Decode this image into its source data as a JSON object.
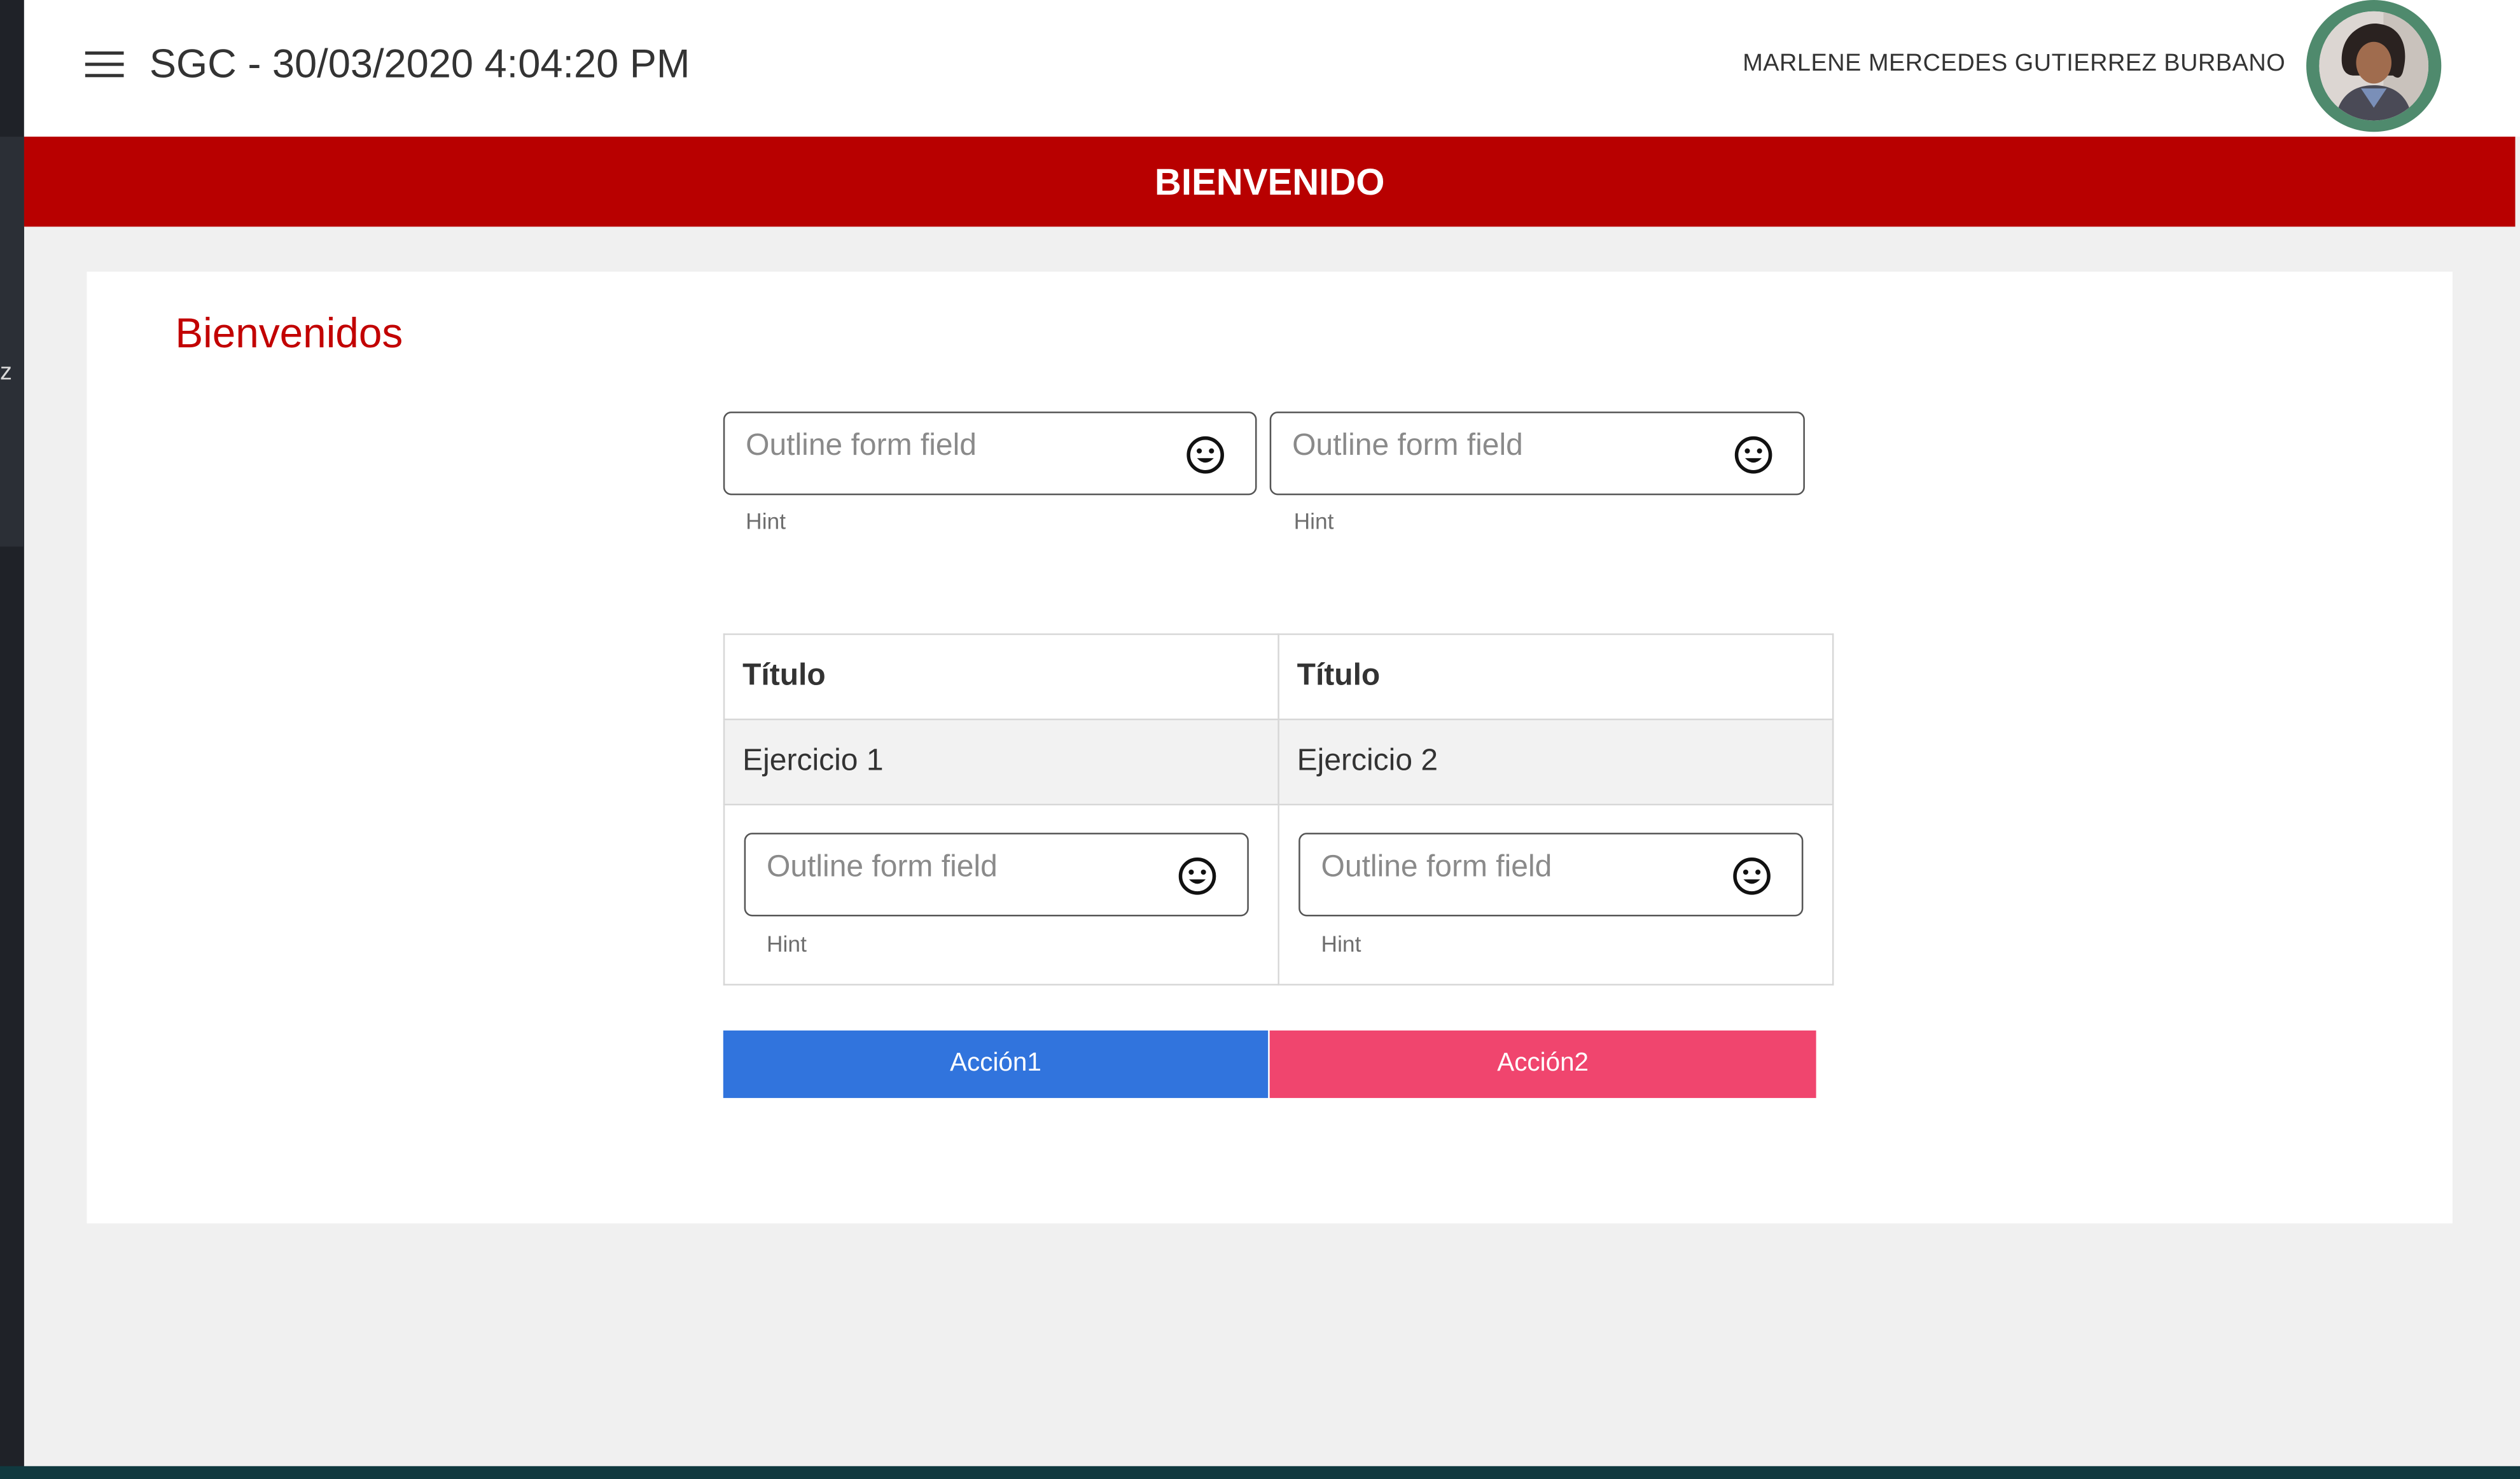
{
  "side_glyph": "z",
  "topbar": {
    "title": "SGC - 30/03/2020 4:04:20 PM",
    "user_name": "MARLENE MERCEDES GUTIERREZ BURBANO"
  },
  "banner": {
    "title": "BIENVENIDO"
  },
  "card": {
    "heading": "Bienvenidos",
    "fields_top": [
      {
        "placeholder": "Outline form field",
        "value": "",
        "hint": "Hint",
        "icon": "smiley-icon"
      },
      {
        "placeholder": "Outline form field",
        "value": "",
        "hint": "Hint",
        "icon": "smiley-icon"
      }
    ],
    "table": {
      "headers": [
        "Título",
        "Título"
      ],
      "rows": [
        [
          "Ejercicio 1",
          "Ejercicio 2"
        ]
      ],
      "fields": [
        {
          "placeholder": "Outline form field",
          "value": "",
          "hint": "Hint",
          "icon": "smiley-icon"
        },
        {
          "placeholder": "Outline form field",
          "value": "",
          "hint": "Hint",
          "icon": "smiley-icon"
        }
      ]
    },
    "actions": [
      {
        "label": "Acción1",
        "color": "#3174dd"
      },
      {
        "label": "Acción2",
        "color": "#f0456e"
      }
    ]
  },
  "colors": {
    "banner": "#b80000",
    "heading": "#c20000",
    "avatar_ring": "#4f8a6d"
  }
}
